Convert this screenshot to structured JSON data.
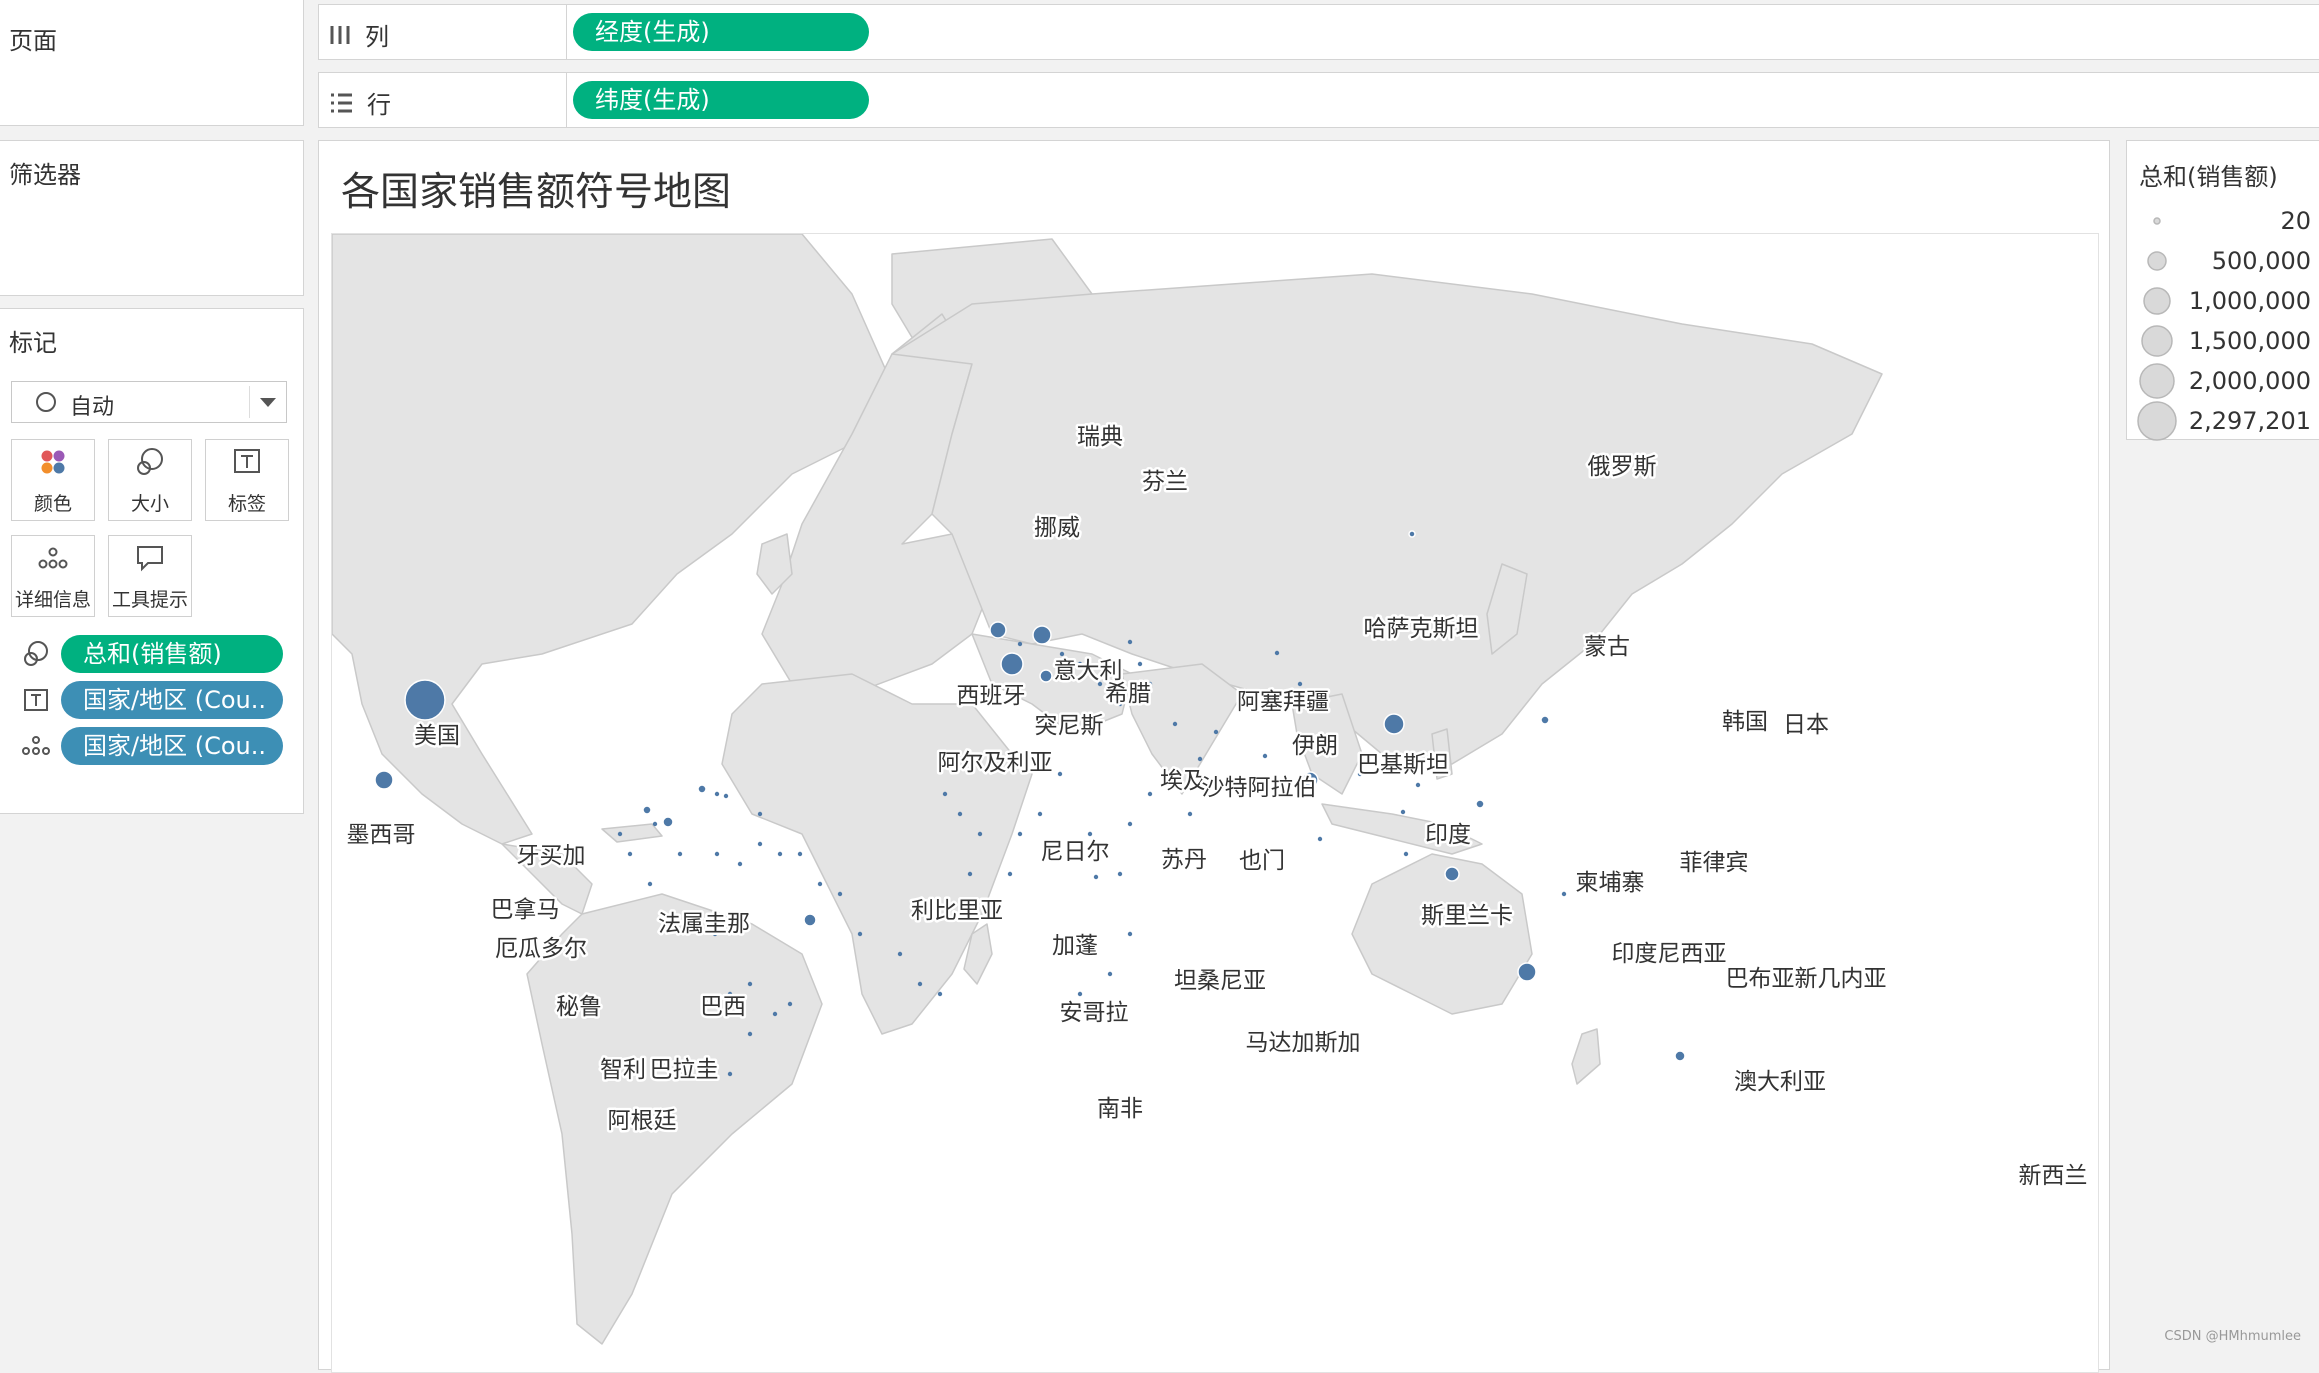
{
  "sidebar": {
    "pages_title": "页面",
    "filters_title": "筛选器",
    "marks_title": "标记",
    "mark_type": "自动",
    "buttons": {
      "color": "颜色",
      "size": "大小",
      "label": "标签",
      "detail": "详细信息",
      "tooltip": "工具提示"
    },
    "mark_pills": [
      "总和(销售额)",
      "国家/地区 (Cou..",
      "国家/地区 (Cou.."
    ]
  },
  "shelves": {
    "columns_label": "列",
    "columns_pill": "经度(生成)",
    "rows_label": "行",
    "rows_pill": "纬度(生成)"
  },
  "view": {
    "title": "各国家销售额符号地图"
  },
  "legend": {
    "title": "总和(销售额)",
    "items": [
      "20",
      "500,000",
      "1,000,000",
      "1,500,000",
      "2,000,000",
      "2,297,201"
    ]
  },
  "colors": {
    "mark": "#4e79a7",
    "pill_green": "#00b180",
    "pill_blue": "#3d8fb5",
    "land": "#e4e4e4"
  },
  "countries": [
    {
      "name": "瑞典"
    },
    {
      "name": "芬兰"
    },
    {
      "name": "挪威"
    },
    {
      "name": "俄罗斯"
    },
    {
      "name": "哈萨克斯坦"
    },
    {
      "name": "蒙古"
    },
    {
      "name": "意大利"
    },
    {
      "name": "西班牙"
    },
    {
      "name": "希腊"
    },
    {
      "name": "阿塞拜疆"
    },
    {
      "name": "突尼斯"
    },
    {
      "name": "伊朗"
    },
    {
      "name": "美国"
    },
    {
      "name": "韩国"
    },
    {
      "name": "日本"
    },
    {
      "name": "阿尔及利亚"
    },
    {
      "name": "埃及"
    },
    {
      "name": "巴基斯坦"
    },
    {
      "name": "沙特阿拉伯"
    },
    {
      "name": "墨西哥"
    },
    {
      "name": "印度"
    },
    {
      "name": "牙买加"
    },
    {
      "name": "尼日尔"
    },
    {
      "name": "苏丹"
    },
    {
      "name": "也门"
    },
    {
      "name": "菲律宾"
    },
    {
      "name": "柬埔寨"
    },
    {
      "name": "巴拿马"
    },
    {
      "name": "利比里亚"
    },
    {
      "name": "法属圭那"
    },
    {
      "name": "斯里兰卡"
    },
    {
      "name": "加蓬"
    },
    {
      "name": "厄瓜多尔"
    },
    {
      "name": "印度尼西亚"
    },
    {
      "name": "坦桑尼亚"
    },
    {
      "name": "巴布亚新几内亚"
    },
    {
      "name": "秘鲁"
    },
    {
      "name": "巴西"
    },
    {
      "name": "安哥拉"
    },
    {
      "name": "马达加斯加"
    },
    {
      "name": "智利"
    },
    {
      "name": "巴拉圭"
    },
    {
      "name": "澳大利亚"
    },
    {
      "name": "南非"
    },
    {
      "name": "阿根廷"
    },
    {
      "name": "新西兰"
    }
  ],
  "watermark": "CSDN @HMhmumlee"
}
